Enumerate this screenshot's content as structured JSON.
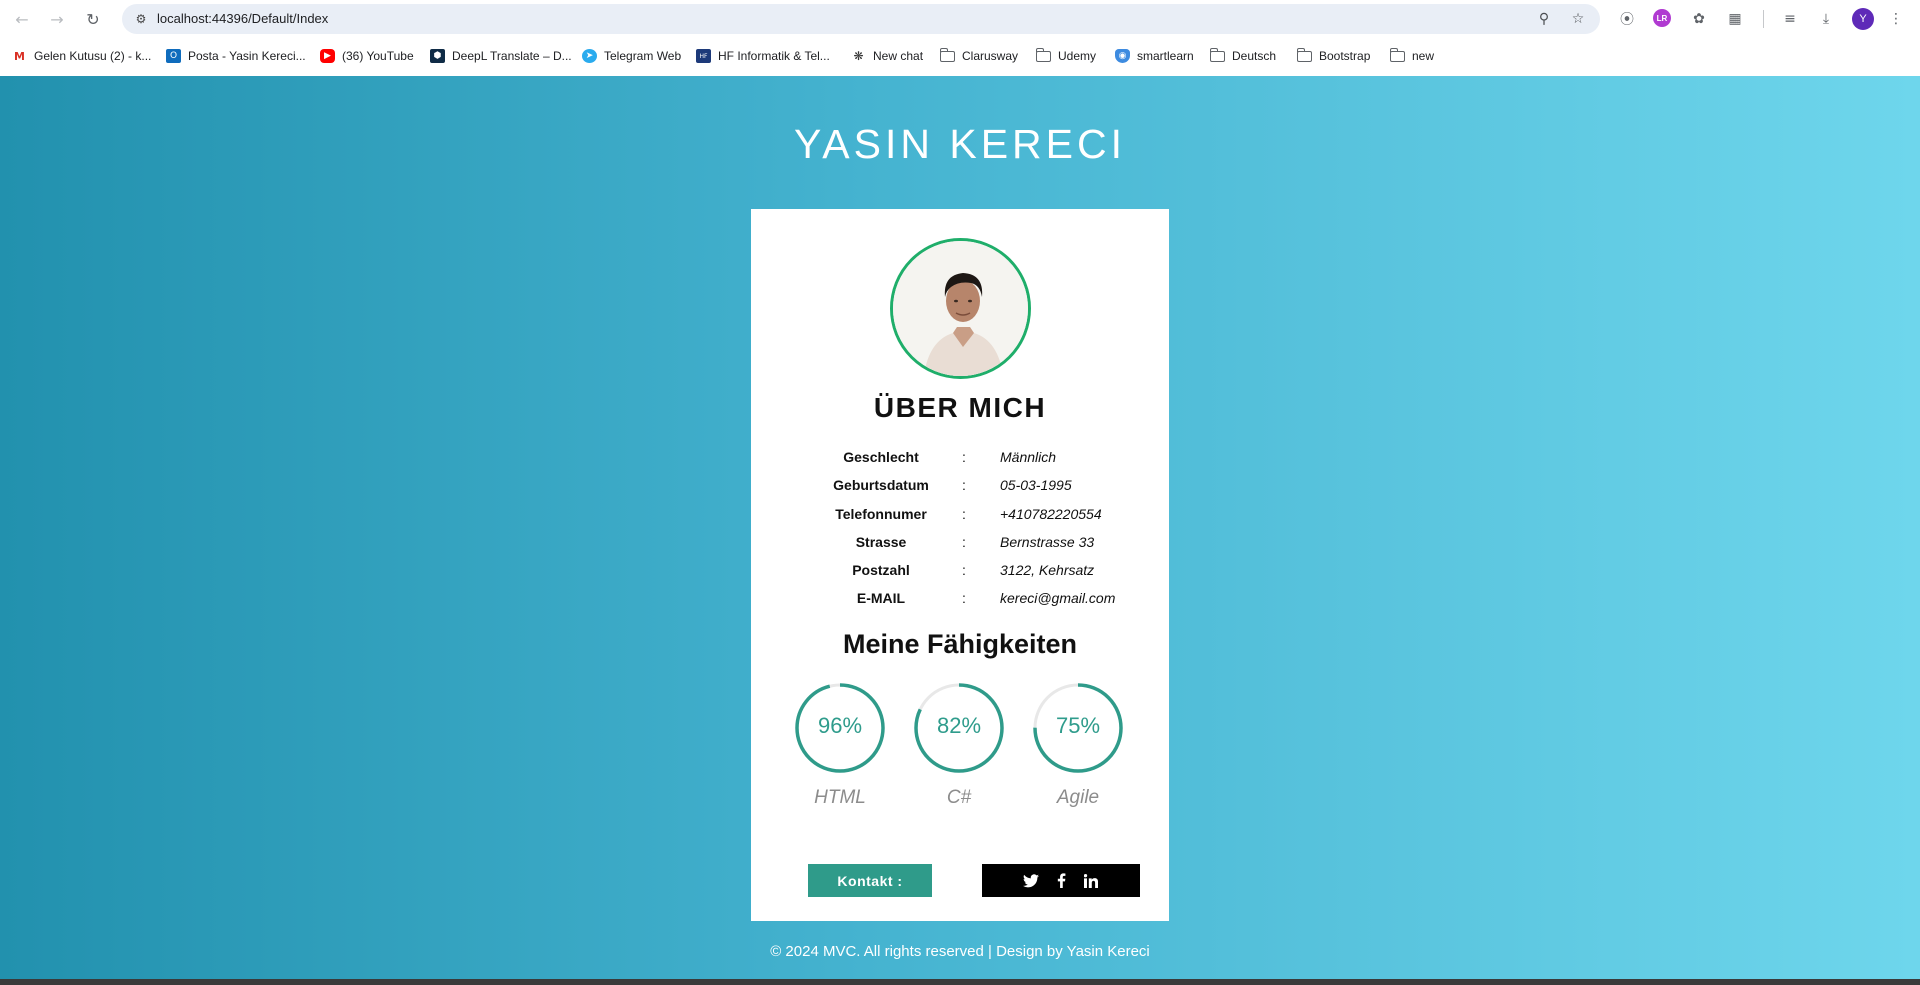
{
  "browser": {
    "url": "localhost:44396/Default/Index",
    "avatar_letter": "Y",
    "ext_badge": "LR",
    "bookmarks": [
      {
        "label": "Gelen Kutusu (2) - k...",
        "icon": "gmail-icon"
      },
      {
        "label": "Posta - Yasin Kereci...",
        "icon": "outlook-icon"
      },
      {
        "label": "(36) YouTube",
        "icon": "youtube-icon"
      },
      {
        "label": "DeepL Translate – D...",
        "icon": "deepl-icon"
      },
      {
        "label": "Telegram Web",
        "icon": "telegram-icon"
      },
      {
        "label": "HF Informatik & Tel...",
        "icon": "hf-icon"
      },
      {
        "label": "New chat",
        "icon": "openai-icon"
      },
      {
        "label": "Clarusway",
        "icon": "folder-icon"
      },
      {
        "label": "Udemy",
        "icon": "folder-icon"
      },
      {
        "label": "smartlearn",
        "icon": "smartlearn-icon"
      },
      {
        "label": "Deutsch",
        "icon": "folder-icon"
      },
      {
        "label": "Bootstrap",
        "icon": "folder-icon"
      },
      {
        "label": "new",
        "icon": "folder-icon"
      }
    ]
  },
  "page": {
    "title": "YASIN KERECI",
    "about_title": "ÜBER MICH",
    "info": [
      {
        "label": "Geschlecht",
        "colon": ":",
        "value": "Männlich"
      },
      {
        "label": "Geburtsdatum",
        "colon": ":",
        "value": "05-03-1995"
      },
      {
        "label": "Telefonnumer",
        "colon": ":",
        "value": "+410782220554"
      },
      {
        "label": "Strasse",
        "colon": ":",
        "value": "Bernstrasse 33"
      },
      {
        "label": "Postzahl",
        "colon": ":",
        "value": "3122, Kehrsatz"
      },
      {
        "label": "E-MAIL",
        "colon": ":",
        "value": "kereci@gmail.com"
      }
    ],
    "skills_title": "Meine Fähigkeiten",
    "skills": [
      {
        "name": "HTML",
        "value_text": "96%",
        "percent": 96
      },
      {
        "name": "C#",
        "value_text": "82%",
        "percent": 82
      },
      {
        "name": "Agile",
        "value_text": "75%",
        "percent": 75
      }
    ],
    "contact_label": "Kontakt :",
    "social_icons": [
      "twitter-icon",
      "facebook-icon",
      "linkedin-icon"
    ],
    "footer": "© 2024 MVC. All rights reserved | Design by Yasin Kereci"
  },
  "colors": {
    "accent": "#2f9b8a",
    "avatar_ring": "#1fae6a",
    "gradient_start": "#2291ae",
    "gradient_end": "#6ed6ec"
  }
}
